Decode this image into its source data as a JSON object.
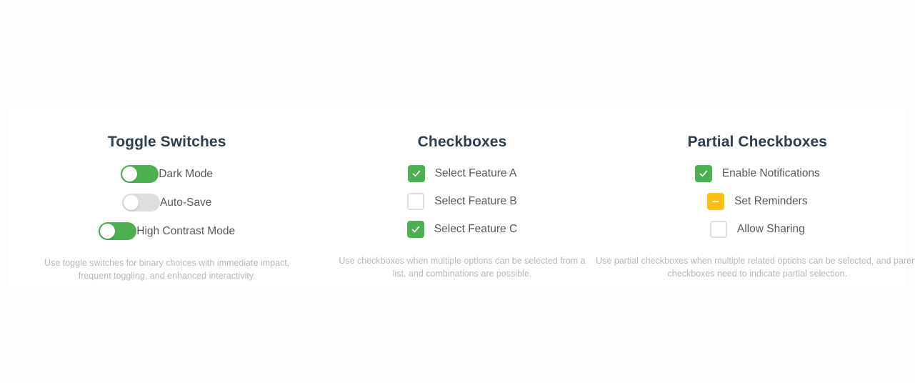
{
  "columns": [
    {
      "title": "Toggle Switches",
      "control_type": "toggle",
      "items": [
        {
          "label": "Dark Mode",
          "state": "on"
        },
        {
          "label": "Auto-Save",
          "state": "off"
        },
        {
          "label": "High Contrast Mode",
          "state": "on"
        }
      ],
      "description": "Use toggle switches for binary choices with immediate impact, frequent toggling, and enhanced interactivity."
    },
    {
      "title": "Checkboxes",
      "control_type": "checkbox",
      "items": [
        {
          "label": "Select Feature A",
          "state": "checked"
        },
        {
          "label": "Select Feature B",
          "state": "unchecked"
        },
        {
          "label": "Select Feature C",
          "state": "checked"
        }
      ],
      "description": "Use checkboxes when multiple options can be selected from a list, and combinations are possible."
    },
    {
      "title": "Partial Checkboxes",
      "control_type": "checkbox",
      "items": [
        {
          "label": "Enable Notifications",
          "state": "checked"
        },
        {
          "label": "Set Reminders",
          "state": "partial"
        },
        {
          "label": "Allow Sharing",
          "state": "unchecked"
        }
      ],
      "description": "Use partial checkboxes when multiple related options can be selected, and parent checkboxes need to indicate partial selection."
    }
  ],
  "colors": {
    "on_green": "#4caf50",
    "partial_amber": "#fdc010",
    "off_gray": "#dedede",
    "title_text": "#2d3e50",
    "label_text": "#55595c",
    "description_text": "#b6b9bc",
    "card_background": "#ffffff",
    "page_background": "#fdfdfd"
  }
}
